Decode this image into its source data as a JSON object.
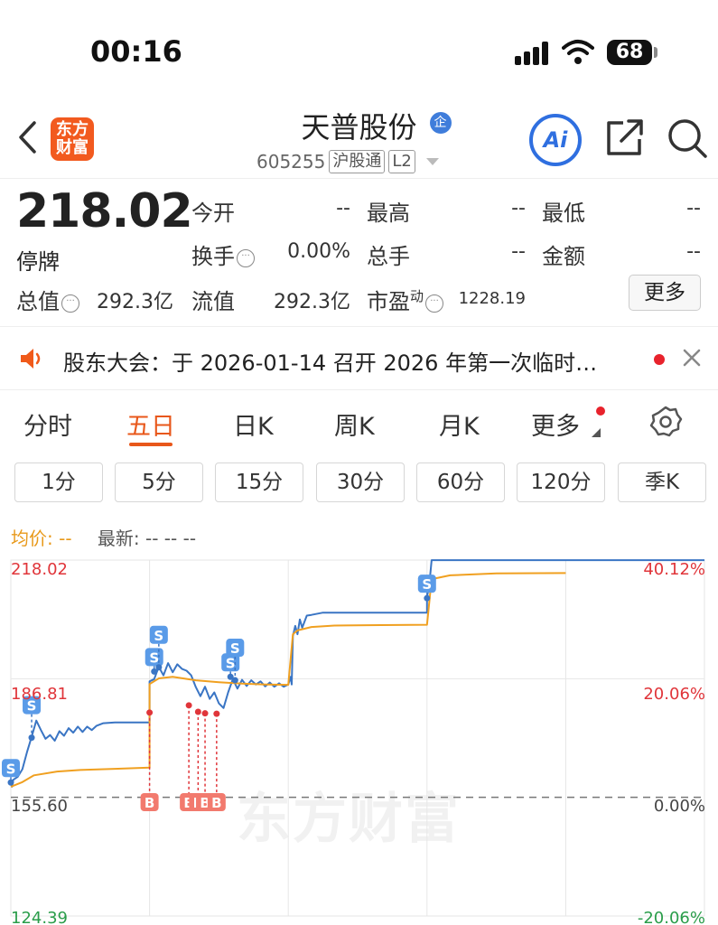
{
  "status_bar": {
    "time": "00:16",
    "battery": "68"
  },
  "header": {
    "logo_line1": "东方",
    "logo_line2": "财富",
    "stock_name": "天普股份",
    "enterprise_badge": "企",
    "stock_code": "605255",
    "market_tag": "沪股通",
    "level_tag": "L2",
    "ai_label": "Ai"
  },
  "quote": {
    "price": "218.02",
    "status": "停牌",
    "open_label": "今开",
    "open_value": "--",
    "high_label": "最高",
    "high_value": "--",
    "low_label": "最低",
    "low_value": "--",
    "turnover_label": "换手",
    "turnover_value": "0.00%",
    "volume_label": "总手",
    "volume_value": "--",
    "amount_label": "金额",
    "amount_value": "--",
    "mktcap_label": "总值",
    "mktcap_value": "292.3亿",
    "float_label": "流值",
    "float_value": "292.3亿",
    "pe_label": "市盈",
    "pe_sup": "动",
    "pe_value": "1228.19",
    "more_label": "更多"
  },
  "notice": {
    "text": "股东大会：于 2026-01-14 召开 2026 年第一次临时…"
  },
  "tabs": [
    {
      "label": "分时"
    },
    {
      "label": "五日"
    },
    {
      "label": "日K"
    },
    {
      "label": "周K"
    },
    {
      "label": "月K"
    },
    {
      "label": "更多"
    }
  ],
  "intervals": [
    "1分",
    "5分",
    "15分",
    "30分",
    "60分",
    "120分",
    "季K"
  ],
  "legend": {
    "avg_label": "均价:",
    "avg_value": "--",
    "latest_label": "最新:",
    "latest_value": "-- -- --"
  },
  "chart": {
    "watermark": "东方财富",
    "price_labels": [
      "218.02",
      "186.81",
      "155.60",
      "124.39"
    ],
    "pct_labels": [
      "40.12%",
      "20.06%",
      "0.00%",
      "-20.06%"
    ],
    "buy_marker": "B",
    "sell_marker": "S"
  },
  "colors": {
    "accent": "#e8571a",
    "price_line": "#3a75c4",
    "avg_line": "#f0a020",
    "up": "#e0353a",
    "down": "#2a9d4a"
  },
  "chart_data": {
    "type": "line",
    "title": "",
    "ylim": [
      124.39,
      218.02
    ],
    "baseline": 155.6,
    "days": 5,
    "series": [
      {
        "values": [
          [
            0,
            159.5
          ],
          [
            0.5,
            158.4
          ],
          [
            1,
            160.2
          ],
          [
            3,
            161.0
          ],
          [
            5,
            163.0
          ],
          [
            7,
            167.5
          ],
          [
            9,
            171.5
          ],
          [
            11,
            175.8
          ],
          [
            13,
            173.3
          ],
          [
            15,
            171.0
          ],
          [
            17,
            172.0
          ],
          [
            19,
            170.5
          ],
          [
            21,
            173.0
          ],
          [
            23,
            171.8
          ],
          [
            25,
            173.8
          ],
          [
            27,
            172.6
          ],
          [
            29,
            174.2
          ],
          [
            31,
            172.8
          ],
          [
            33,
            174.2
          ],
          [
            35,
            173.3
          ],
          [
            37,
            174.4
          ],
          [
            40,
            175.1
          ],
          [
            45,
            175.3
          ],
          [
            55,
            175.3
          ],
          [
            60,
            175.3
          ],
          [
            60,
            186.1
          ],
          [
            62,
            186.7
          ],
          [
            64,
            189.9
          ],
          [
            66,
            187.7
          ],
          [
            68,
            190.9
          ],
          [
            70,
            188.5
          ],
          [
            72,
            190.6
          ],
          [
            74,
            189.4
          ],
          [
            76,
            188.9
          ],
          [
            78,
            187.7
          ],
          [
            80,
            184.6
          ],
          [
            82,
            182.2
          ],
          [
            84,
            184.7
          ],
          [
            86,
            181.5
          ],
          [
            88,
            183.2
          ],
          [
            90,
            180.3
          ],
          [
            92,
            179.1
          ],
          [
            94,
            183.2
          ],
          [
            96,
            186.7
          ],
          [
            98,
            184.2
          ],
          [
            100,
            186.5
          ],
          [
            102,
            184.9
          ],
          [
            104,
            186.4
          ],
          [
            106,
            185.3
          ],
          [
            108,
            186.1
          ],
          [
            110,
            184.8
          ],
          [
            112,
            185.8
          ],
          [
            114,
            184.7
          ],
          [
            116,
            185.6
          ],
          [
            118,
            184.7
          ],
          [
            120,
            185.3
          ],
          [
            121,
            187.3
          ],
          [
            121.5,
            185.3
          ],
          [
            122,
            198.0
          ],
          [
            123,
            200.7
          ],
          [
            124,
            198.5
          ],
          [
            125,
            202.4
          ],
          [
            126,
            200.2
          ],
          [
            128,
            203.4
          ],
          [
            130,
            203.6
          ],
          [
            135,
            204.2
          ],
          [
            150,
            204.2
          ],
          [
            180,
            204.2
          ],
          [
            180,
            208.2
          ],
          [
            181,
            211.7
          ],
          [
            182,
            218.0
          ],
          [
            200,
            218.0
          ],
          [
            240,
            218.0
          ],
          [
            300,
            218.0
          ]
        ]
      },
      {
        "values": [
          [
            0,
            158.4
          ],
          [
            5,
            159.6
          ],
          [
            10,
            161.4
          ],
          [
            20,
            162.4
          ],
          [
            30,
            162.8
          ],
          [
            45,
            163.1
          ],
          [
            60,
            163.4
          ],
          [
            60,
            185.4
          ],
          [
            64,
            186.9
          ],
          [
            70,
            187.3
          ],
          [
            80,
            186.4
          ],
          [
            90,
            185.9
          ],
          [
            100,
            185.5
          ],
          [
            110,
            185.3
          ],
          [
            120,
            185.2
          ],
          [
            122,
            198.5
          ],
          [
            124,
            199.5
          ],
          [
            130,
            200.4
          ],
          [
            140,
            200.8
          ],
          [
            160,
            200.9
          ],
          [
            180,
            201.0
          ],
          [
            182,
            213.0
          ],
          [
            190,
            214.0
          ],
          [
            210,
            214.5
          ],
          [
            240,
            214.6
          ]
        ]
      }
    ],
    "buy_points": [
      [
        60,
        177.9
      ],
      [
        77,
        179.8
      ],
      [
        81,
        178.1
      ],
      [
        84,
        177.7
      ],
      [
        89,
        177.6
      ]
    ],
    "sell_points": [
      [
        0,
        159.5
      ],
      [
        9,
        171.3
      ],
      [
        62,
        188.7
      ],
      [
        64,
        189.8
      ],
      [
        95,
        187.3
      ],
      [
        97,
        186.4
      ],
      [
        180,
        208.0
      ]
    ]
  }
}
